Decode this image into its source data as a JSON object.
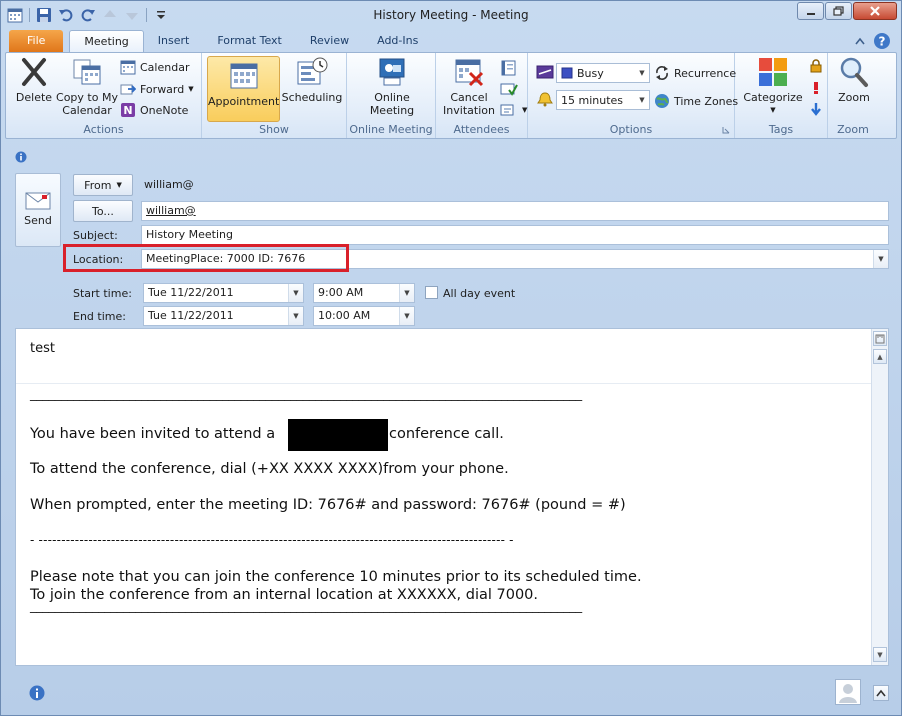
{
  "window": {
    "title": "History Meeting - Meeting"
  },
  "quick_access": [
    "app-icon",
    "save-icon",
    "undo-icon",
    "redo-icon",
    "up-icon",
    "down-icon",
    "customize-icon"
  ],
  "tabs": [
    {
      "label": "File"
    },
    {
      "label": "Meeting"
    },
    {
      "label": "Insert"
    },
    {
      "label": "Format Text"
    },
    {
      "label": "Review"
    },
    {
      "label": "Add-Ins"
    }
  ],
  "ribbon": {
    "actions": {
      "label": "Actions",
      "delete": "Delete",
      "copy_to_my_calendar": "Copy to My Calendar",
      "calendar": "Calendar",
      "forward": "Forward",
      "onenote": "OneNote"
    },
    "show": {
      "label": "Show",
      "appointment": "Appointment",
      "scheduling": "Scheduling"
    },
    "online_meeting": {
      "label": "Online Meeting",
      "button": "Online Meeting"
    },
    "attendees": {
      "label": "Attendees",
      "cancel_invitation": "Cancel Invitation"
    },
    "options": {
      "label": "Options",
      "show_as": "Busy",
      "reminder": "15 minutes",
      "recurrence": "Recurrence",
      "time_zones": "Time Zones"
    },
    "tags": {
      "label": "Tags",
      "categorize": "Categorize"
    },
    "zoom": {
      "label": "Zoom",
      "button": "Zoom"
    }
  },
  "form": {
    "send": "Send",
    "from_button": "From",
    "from_value": "william@",
    "to_button": "To...",
    "to_value": "william@",
    "subject_label": "Subject:",
    "subject_value": "History Meeting",
    "location_label": "Location:",
    "location_value": "MeetingPlace: 7000 ID: 7676",
    "start_label": "Start time:",
    "start_date": "Tue 11/22/2011",
    "start_time": "9:00 AM",
    "end_label": "End time:",
    "end_date": "Tue 11/22/2011",
    "end_time": "10:00 AM",
    "all_day_label": "All day event"
  },
  "body": {
    "line1": "test",
    "rule1": "_________________________________________________________________________________________",
    "invite_pre": "You have been invited to attend a",
    "invite_post": "conference call.",
    "dial": "To attend the conference, dial (+XX XXXX XXXX)from your phone.",
    "prompt": "When prompted, enter the meeting ID: 7676# and password: 7676# (pound = #)",
    "dashes": "- -------------------------------------------------------------------------------------------------------  -",
    "note1": "Please note that you can join the conference 10 minutes prior to its scheduled time.",
    "note2": "To join the conference from an internal location at XXXXXX, dial 7000.",
    "rule2": "_________________________________________________________________________________________"
  },
  "colors": {
    "accent_red": "#d9202a",
    "file_tab": "#e0761a",
    "ribbon_bg": "#e3edf9"
  }
}
